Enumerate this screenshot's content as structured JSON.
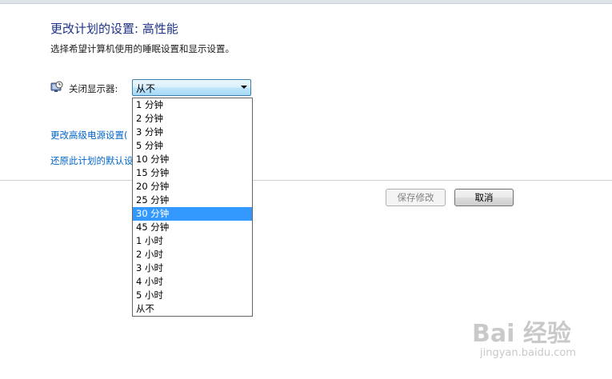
{
  "header": {
    "title": "更改计划的设置: 高性能",
    "subtitle": "选择希望计算机使用的睡眠设置和显示设置。"
  },
  "display_setting": {
    "label": "关闭显示器:",
    "selected": "从不",
    "icon": "monitor-clock-icon"
  },
  "links": {
    "advanced": "更改高级电源设置(",
    "restore": "还原此计划的默认设"
  },
  "buttons": {
    "save": "保存修改",
    "cancel": "取消"
  },
  "dropdown": {
    "options": [
      "1 分钟",
      "2 分钟",
      "3 分钟",
      "5 分钟",
      "10 分钟",
      "15 分钟",
      "20 分钟",
      "25 分钟",
      "30 分钟",
      "45 分钟",
      "1 小时",
      "2 小时",
      "3 小时",
      "4 小时",
      "5 小时",
      "从不"
    ],
    "highlighted": "30 分钟"
  },
  "watermark": {
    "logo": "Bai 经验",
    "url": "jingyan.baidu.com"
  },
  "colors": {
    "title": "#1e3287",
    "link": "#0066cc",
    "highlight": "#3399ff"
  }
}
